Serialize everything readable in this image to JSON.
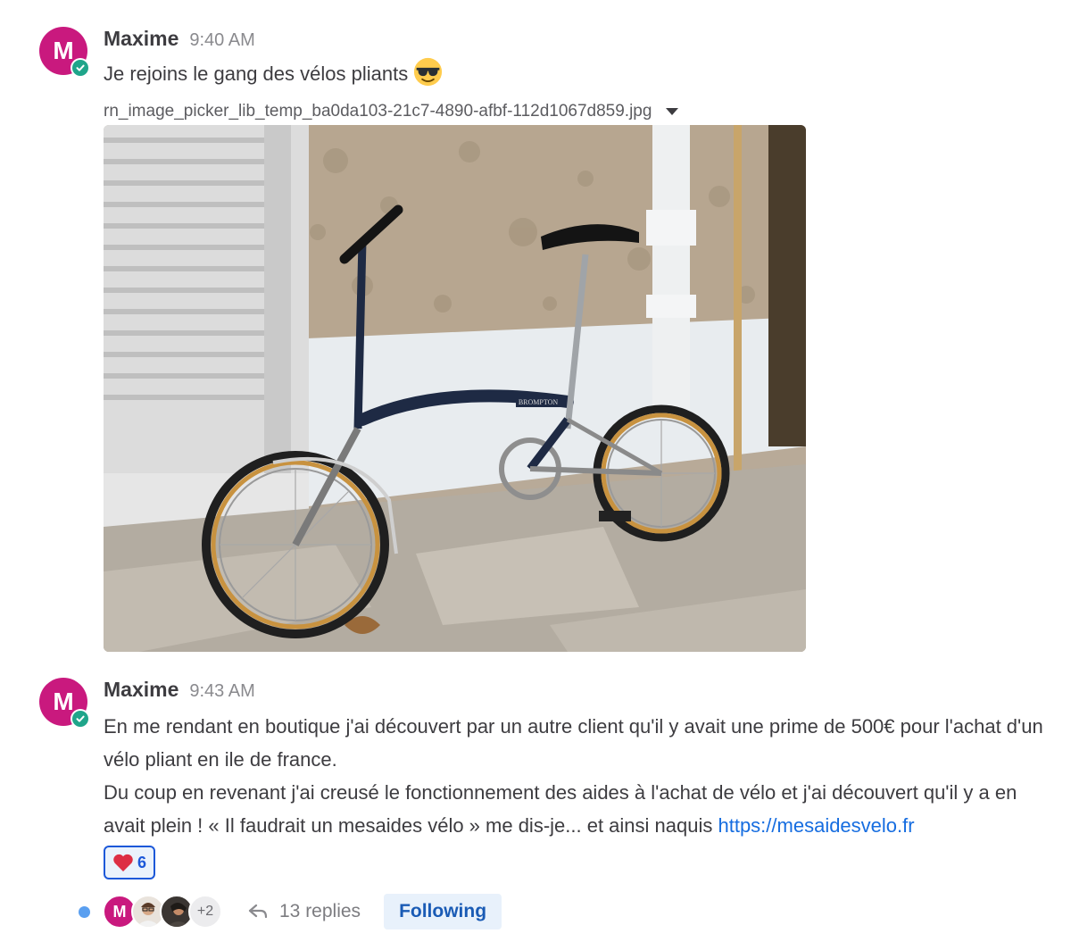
{
  "colors": {
    "avatar_bg": "#c9197e",
    "status_online": "#1fa58a",
    "link": "#166de0",
    "reaction_border": "#1c58d9",
    "follow_bg": "#e8f1fb"
  },
  "posts": [
    {
      "author": "Maxime",
      "avatar_initial": "M",
      "time": "9:40 AM",
      "message": "Je rejoins le gang des vélos pliants",
      "emoji": "smiling-face-with-sunglasses",
      "attachment": {
        "filename": "rn_image_picker_lib_temp_ba0da103-21c7-4890-afbf-112d1067d859.jpg",
        "bike_brand_label": "BROMPTON"
      }
    },
    {
      "author": "Maxime",
      "avatar_initial": "M",
      "time": "9:43 AM",
      "paragraph_1": "En me rendant en boutique j'ai découvert par un autre client qu'il y avait une prime de 500€ pour l'achat d'un vélo pliant en ile de france.",
      "paragraph_2": "Du coup en revenant j'ai creusé le fonctionnement des aides à l'achat de vélo et j'ai découvert qu'il y a en avait plein ! « Il faudrait un mesaides vélo » me dis-je... et ainsi naquis ",
      "link_text": "https://mesaidesvelo.fr",
      "reaction": {
        "emoji": "heart",
        "count": "6"
      },
      "thread": {
        "participant_initial": "M",
        "more_participants": "+2",
        "replies": "13 replies",
        "follow_label": "Following"
      }
    }
  ]
}
